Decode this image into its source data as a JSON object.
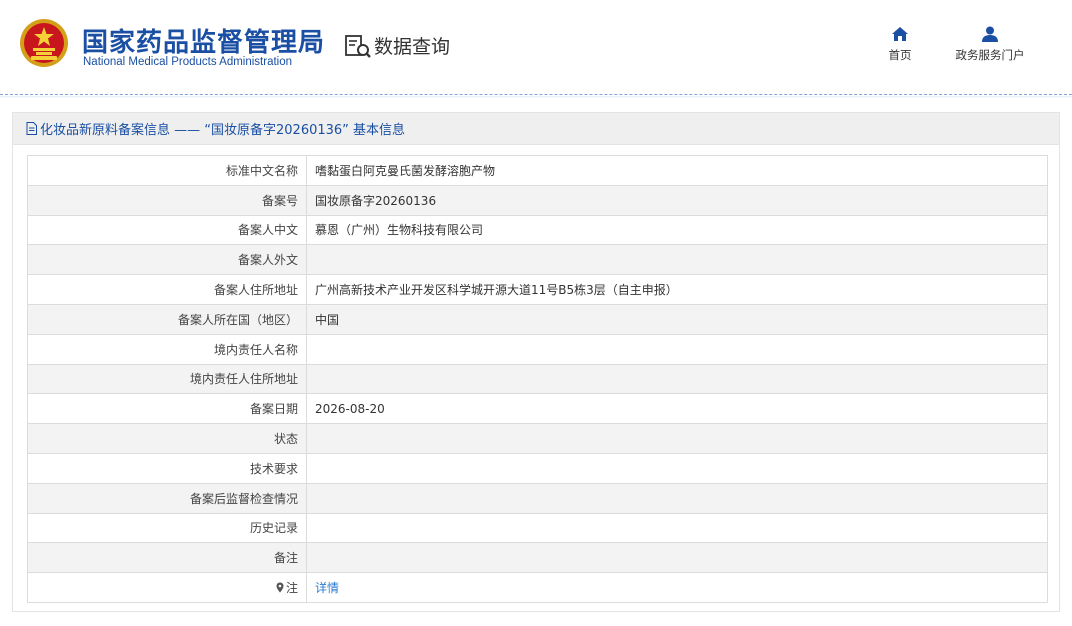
{
  "header": {
    "brand_cn": "国家药品监督管理局",
    "brand_en": "National Medical Products Administration",
    "query_title": "数据查询",
    "nav": {
      "home_label": "首页",
      "portal_label": "政务服务门户"
    }
  },
  "panel": {
    "title": "化妆品新原料备案信息 —— “国妆原备字20260136” 基本信息"
  },
  "rows": [
    {
      "label": "标准中文名称",
      "value": "嗜黏蛋白阿克曼氏菌发酵溶胞产物"
    },
    {
      "label": "备案号",
      "value": "国妆原备字20260136"
    },
    {
      "label": "备案人中文",
      "value": "慕恩（广州）生物科技有限公司"
    },
    {
      "label": "备案人外文",
      "value": ""
    },
    {
      "label": "备案人住所地址",
      "value": "广州高新技术产业开发区科学城开源大道11号B5栋3层（自主申报）"
    },
    {
      "label": "备案人所在国（地区）",
      "value": "中国"
    },
    {
      "label": "境内责任人名称",
      "value": ""
    },
    {
      "label": "境内责任人住所地址",
      "value": ""
    },
    {
      "label": "备案日期",
      "value": "2026-08-20"
    },
    {
      "label": "状态",
      "value": ""
    },
    {
      "label": "技术要求",
      "value": ""
    },
    {
      "label": "备案后监督检查情况",
      "value": ""
    },
    {
      "label": "历史记录",
      "value": ""
    },
    {
      "label": "备注",
      "value": ""
    },
    {
      "label": "注",
      "value": "详情"
    }
  ],
  "colors": {
    "brand_blue": "#1a4fa3",
    "link_blue": "#2b7bd0",
    "row_alt": "#f3f3f3"
  },
  "icons": {
    "emblem": "national-emblem-icon",
    "query": "document-search-icon",
    "home": "home-icon",
    "portal": "user-icon",
    "panel": "document-icon",
    "note": "location-pin-icon"
  }
}
